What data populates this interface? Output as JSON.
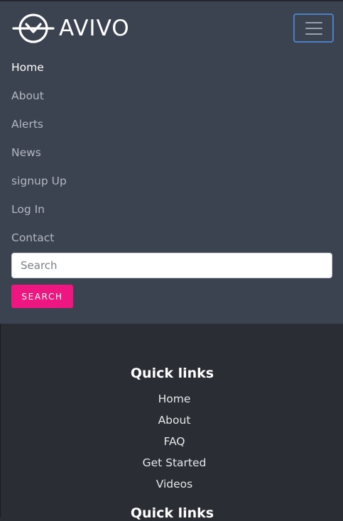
{
  "brand": {
    "name": "AVIVO"
  },
  "nav": {
    "items": [
      {
        "label": "Home",
        "active": true
      },
      {
        "label": "About"
      },
      {
        "label": "Alerts"
      },
      {
        "label": "News"
      },
      {
        "label": "signup Up"
      },
      {
        "label": "Log In"
      },
      {
        "label": "Contact"
      }
    ]
  },
  "search": {
    "placeholder": "Search",
    "button_label": "Search"
  },
  "footer": {
    "heading": "Quick links",
    "links": [
      "Home",
      "About",
      "FAQ",
      "Get Started",
      "Videos"
    ],
    "heading_2": "Quick links"
  },
  "colors": {
    "nav_bg": "#3b4250",
    "page_bg": "#2a2d33",
    "accent": "#ee1680",
    "toggler_border": "#4d7fc2"
  }
}
